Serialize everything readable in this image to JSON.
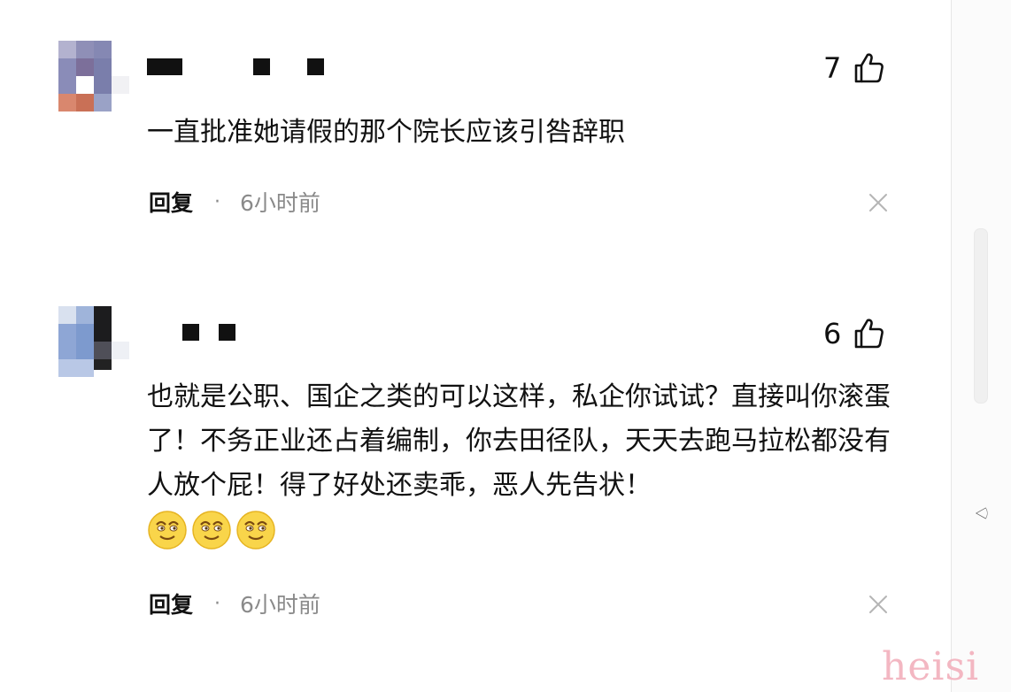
{
  "comments": [
    {
      "likes": "7",
      "text": "一直批准她请假的那个院长应该引咎辞职",
      "emojis": [],
      "reply_label": "回复",
      "separator": "·",
      "time": "6小时前"
    },
    {
      "likes": "6",
      "text": "也就是公职、国企之类的可以这样，私企你试试？直接叫你滚蛋了！不务正业还占着编制，你去田径队，天天去跑马拉松都没有人放个屁！得了好处还卖乖，恶人先告状！",
      "emojis": [
        "smile-emoji",
        "smile-emoji",
        "smile-emoji"
      ],
      "reply_label": "回复",
      "separator": "·",
      "time": "6小时前"
    }
  ],
  "watermark": "heisi",
  "colors": {
    "text": "#111111",
    "meta": "#8a8a8a",
    "watermark": "#f3b7c2",
    "divider": "#e6e6e6"
  }
}
